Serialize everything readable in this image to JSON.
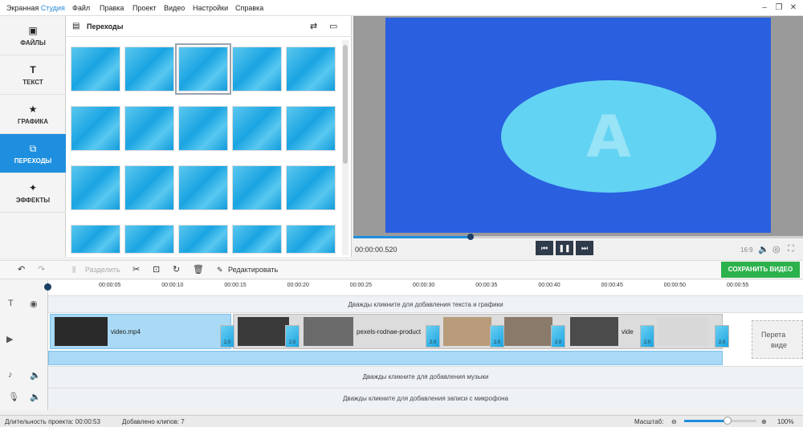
{
  "titlebar": {
    "app_name_part1": "Экранная ",
    "app_name_part2": "Студия",
    "menu": [
      "Файл",
      "Правка",
      "Проект",
      "Видео",
      "Настройки",
      "Справка"
    ],
    "minimize": "–",
    "maximize": "❐",
    "close": "✕"
  },
  "sidebar": {
    "items": [
      {
        "label": "ФАЙЛЫ",
        "icon": "image-icon"
      },
      {
        "label": "ТЕКСТ",
        "icon": "text-icon"
      },
      {
        "label": "ГРАФИКА",
        "icon": "star-icon"
      },
      {
        "label": "ПЕРЕХОДЫ",
        "icon": "transitions-icon"
      },
      {
        "label": "ЭФФЕКТЫ",
        "icon": "magic-wand-icon"
      }
    ],
    "active_index": 3
  },
  "panel": {
    "title": "Переходы",
    "thumbnail_count": 20,
    "selected_index": 2
  },
  "preview": {
    "letter": "A",
    "timecode": "00:00:00.520",
    "aspect": "16:9",
    "progress": 0.26
  },
  "toolbar": {
    "split": "Разделить",
    "edit": "Редактировать",
    "save": "СОХРАНИТЬ ВИДЕО"
  },
  "timeline": {
    "ticks": [
      "00:00:05",
      "00:00:10",
      "00:00:15",
      "00:00:20",
      "00:00:25",
      "00:00:30",
      "00:00:35",
      "00:00:40",
      "00:00:45",
      "00:00:50",
      "00:00:55"
    ],
    "text_hint": "Дважды кликните для добавления текста и графики",
    "clip1": "video.mp4",
    "clip2": "pexels-rodnae-product",
    "clip3": "vide",
    "transition_value": "2.0",
    "drop_text_1": "Перета",
    "drop_text_2": "виде",
    "music_hint": "Дважды кликните для добавления музыки",
    "mic_hint": "Дважды кликните для добавления записи с микрофона"
  },
  "status": {
    "duration": "Длительность проекта: 00:00:53",
    "clips": "Добавлено клипов: 7",
    "zoom_label": "Масштаб:",
    "zoom_value": "100%",
    "zoom_level": 0.6
  },
  "colors": {
    "accent": "#1e8fde",
    "save": "#2bb24c",
    "preview_blue": "#2a5fe0"
  }
}
